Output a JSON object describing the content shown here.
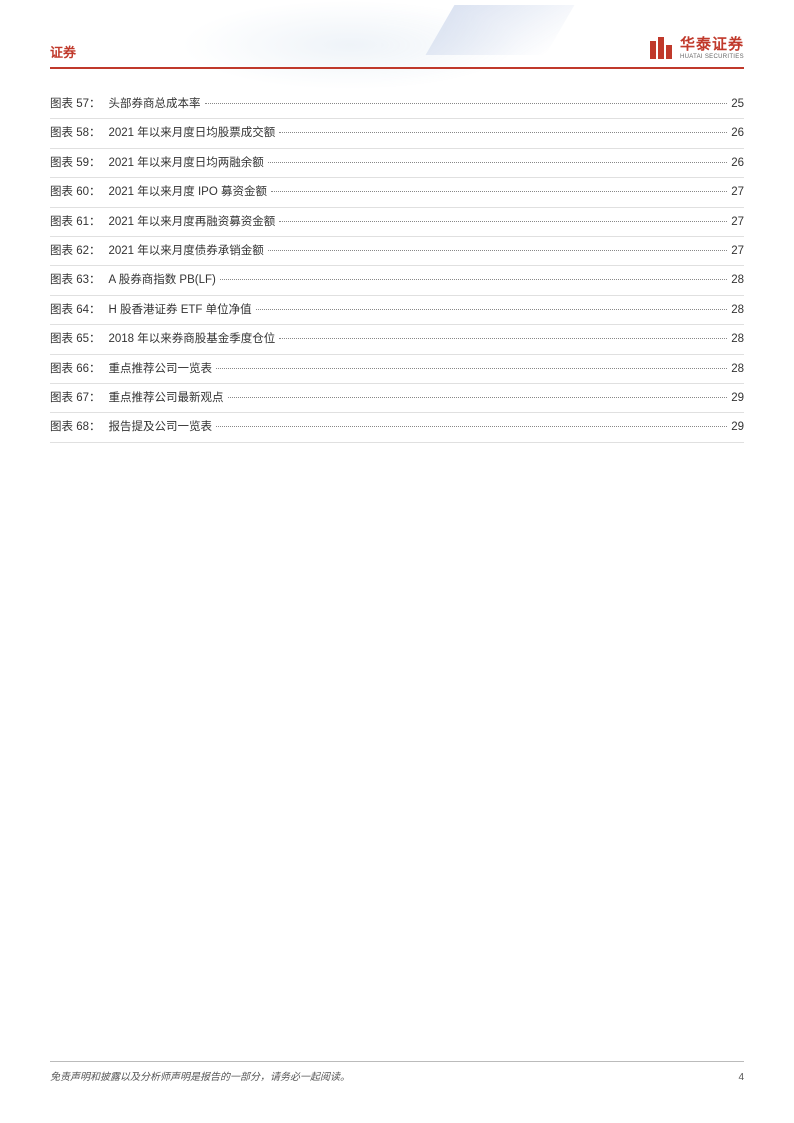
{
  "header": {
    "title": "证券",
    "logo_cn": "华泰证券",
    "logo_en": "HUATAI SECURITIES"
  },
  "toc": [
    {
      "num": "图表 57：",
      "title": "头部券商总成本率",
      "page": "25"
    },
    {
      "num": "图表 58：",
      "title": "2021 年以来月度日均股票成交额",
      "page": "26"
    },
    {
      "num": "图表 59：",
      "title": "2021 年以来月度日均两融余额",
      "page": "26"
    },
    {
      "num": "图表 60：",
      "title": "2021 年以来月度 IPO 募资金额",
      "page": "27"
    },
    {
      "num": "图表 61：",
      "title": "2021 年以来月度再融资募资金额",
      "page": "27"
    },
    {
      "num": "图表 62：",
      "title": "2021 年以来月度债券承销金额",
      "page": "27"
    },
    {
      "num": "图表 63：",
      "title": "A 股券商指数 PB(LF)",
      "page": "28"
    },
    {
      "num": "图表 64：",
      "title": "H 股香港证券 ETF 单位净值",
      "page": "28"
    },
    {
      "num": "图表 65：",
      "title": "2018 年以来券商股基金季度仓位",
      "page": "28"
    },
    {
      "num": "图表 66：",
      "title": "重点推荐公司一览表",
      "page": "28"
    },
    {
      "num": "图表 67：",
      "title": "重点推荐公司最新观点",
      "page": "29"
    },
    {
      "num": "图表 68：",
      "title": "报告提及公司一览表",
      "page": "29"
    }
  ],
  "footer": {
    "disclaimer": "免责声明和披露以及分析师声明是报告的一部分，请务必一起阅读。",
    "page": "4"
  }
}
